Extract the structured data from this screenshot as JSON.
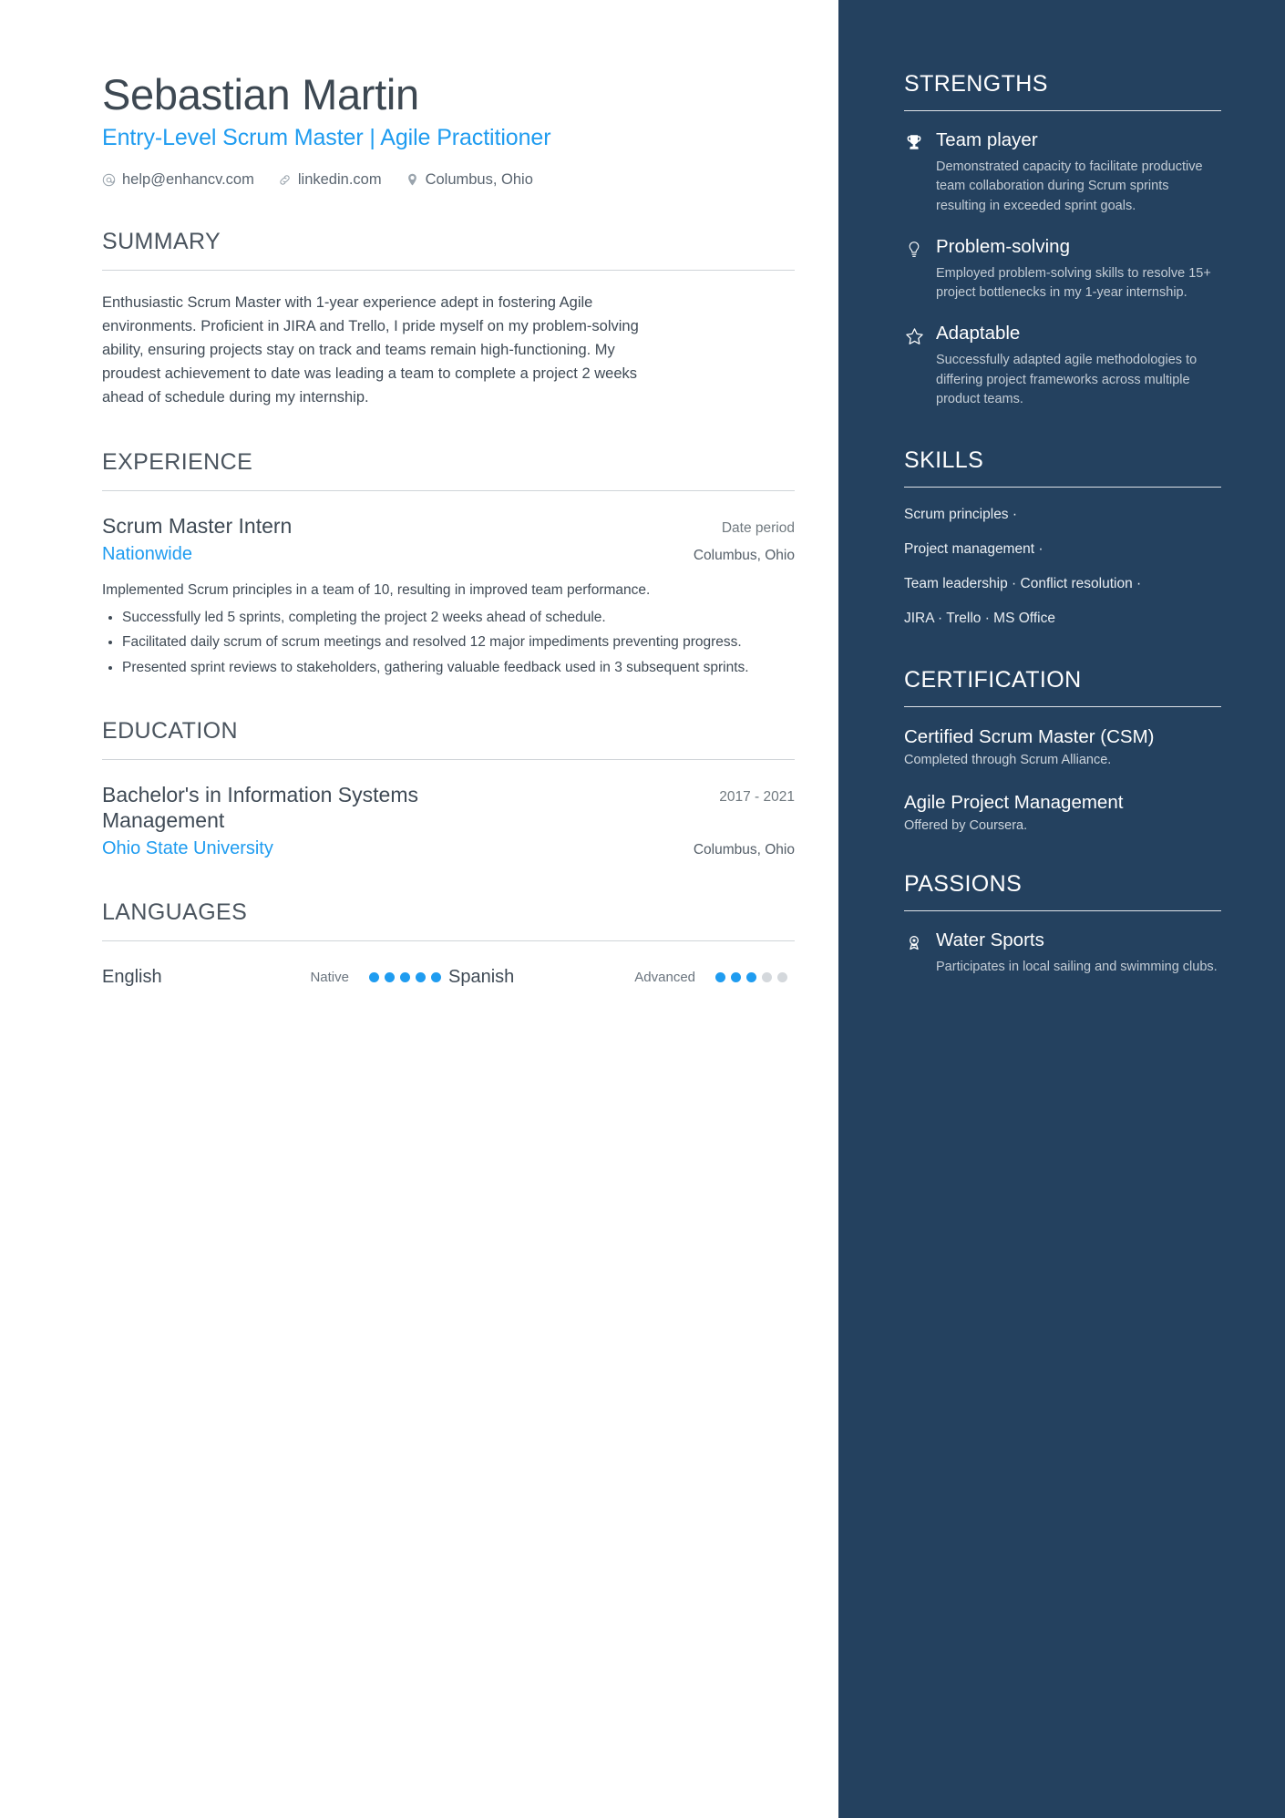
{
  "header": {
    "full_name": "Sebastian Martin",
    "job_title": "Entry-Level Scrum Master | Agile Practitioner",
    "contacts": [
      {
        "icon": "at-icon",
        "label": "help@enhancv.com"
      },
      {
        "icon": "link-icon",
        "label": "linkedin.com"
      },
      {
        "icon": "location-pin-icon",
        "label": "Columbus, Ohio"
      }
    ]
  },
  "summary": {
    "title": "SUMMARY",
    "text": "Enthusiastic Scrum Master with 1-year experience adept in fostering Agile environments. Proficient in JIRA and Trello, I pride myself on my problem-solving ability, ensuring projects stay on track and teams remain high-functioning. My proudest achievement to date was leading a team to complete a project 2 weeks ahead of schedule during my internship."
  },
  "experience": {
    "title": "EXPERIENCE",
    "entries": [
      {
        "role": "Scrum Master Intern",
        "date": "Date period",
        "organization": "Nationwide",
        "location": "Columbus, Ohio",
        "description": "Implemented Scrum principles in a team of 10, resulting in improved team performance.",
        "bullets": [
          "Successfully led 5 sprints, completing the project 2 weeks ahead of schedule.",
          "Facilitated daily scrum of scrum meetings and resolved 12 major impediments preventing progress.",
          "Presented sprint reviews to stakeholders, gathering valuable feedback used in 3 subsequent sprints."
        ]
      }
    ]
  },
  "education": {
    "title": "EDUCATION",
    "entries": [
      {
        "degree": "Bachelor's in Information Systems Management",
        "date": "2017 - 2021",
        "school": "Ohio State University",
        "location": "Columbus, Ohio"
      }
    ]
  },
  "languages": {
    "title": "LANGUAGES",
    "items": [
      {
        "name": "English",
        "level": "Native",
        "filled": 5,
        "total": 5
      },
      {
        "name": "Spanish",
        "level": "Advanced",
        "filled": 3,
        "total": 5
      }
    ]
  },
  "strengths": {
    "title": "STRENGTHS",
    "items": [
      {
        "icon": "trophy-icon",
        "name": "Team player",
        "description": "Demonstrated capacity to facilitate productive team collaboration during Scrum sprints resulting in exceeded sprint goals."
      },
      {
        "icon": "lightbulb-icon",
        "name": "Problem-solving",
        "description": "Employed problem-solving skills to resolve 15+ project bottlenecks in my 1-year internship."
      },
      {
        "icon": "star-icon",
        "name": "Adaptable",
        "description": "Successfully adapted agile methodologies to differing project frameworks across multiple product teams."
      }
    ]
  },
  "skills": {
    "title": "SKILLS",
    "lines": [
      "Scrum principles ·",
      "Project management ·",
      "Team leadership · Conflict resolution ·",
      "JIRA · Trello · MS Office"
    ]
  },
  "certification": {
    "title": "CERTIFICATION",
    "items": [
      {
        "name": "Certified Scrum Master (CSM)",
        "issuer": "Completed through Scrum Alliance."
      },
      {
        "name": "Agile Project Management",
        "issuer": "Offered by Coursera."
      }
    ]
  },
  "passions": {
    "title": "PASSIONS",
    "items": [
      {
        "icon": "medal-icon",
        "name": "Water Sports",
        "description": "Participates in local sailing and swimming clubs."
      }
    ]
  },
  "colors": {
    "accent_blue": "#1f9cf0",
    "sidebar_navy": "#24415f",
    "text_dark": "#3f4a55",
    "rule_gray": "#cfd4d8"
  }
}
